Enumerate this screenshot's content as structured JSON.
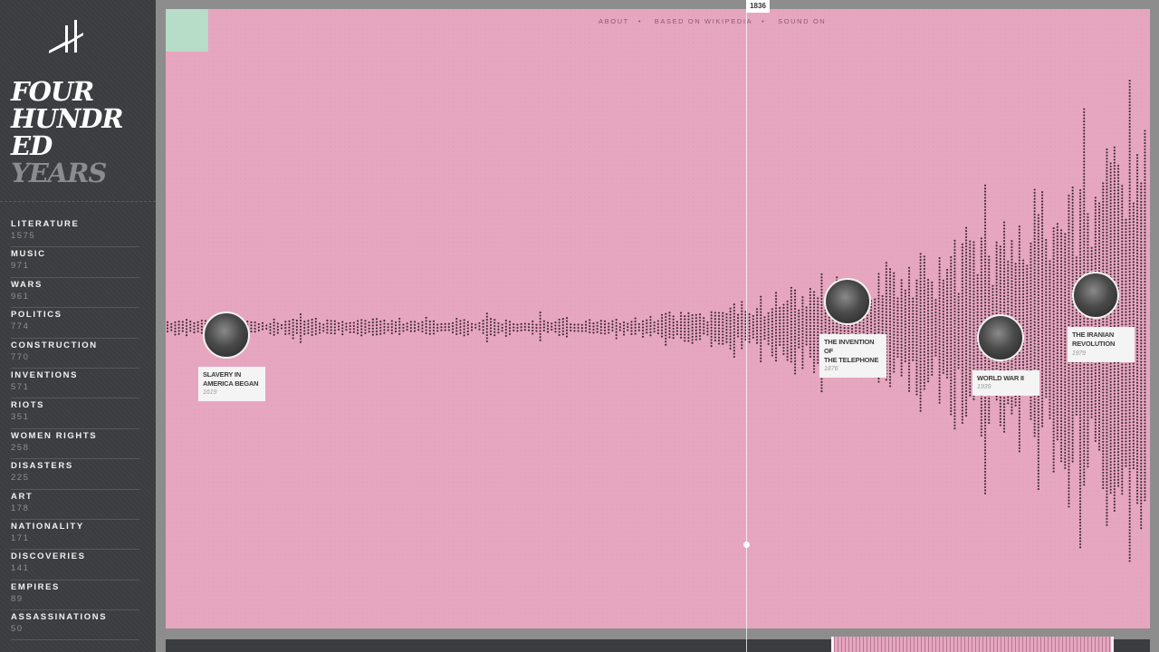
{
  "app": {
    "title_lines": [
      "FOUR",
      "HUNDR",
      "ED"
    ],
    "title_muted": "YEARS"
  },
  "nav": {
    "about": "ABOUT",
    "based_on": "BASED ON WIKIPEDIA",
    "sound": "SOUND ON"
  },
  "categories": [
    {
      "name": "LITERATURE",
      "count": "1575"
    },
    {
      "name": "MUSIC",
      "count": "971"
    },
    {
      "name": "WARS",
      "count": "961"
    },
    {
      "name": "POLITICS",
      "count": "774"
    },
    {
      "name": "CONSTRUCTION",
      "count": "770"
    },
    {
      "name": "INVENTIONS",
      "count": "571"
    },
    {
      "name": "RIOTS",
      "count": "351"
    },
    {
      "name": "WOMEN RIGHTS",
      "count": "258"
    },
    {
      "name": "DISASTERS",
      "count": "225"
    },
    {
      "name": "ART",
      "count": "178"
    },
    {
      "name": "NATIONALITY",
      "count": "171"
    },
    {
      "name": "DISCOVERIES",
      "count": "141"
    },
    {
      "name": "EMPIRES",
      "count": "89"
    },
    {
      "name": "ASSASSINATIONS",
      "count": "50"
    }
  ],
  "cursor": {
    "year": "1836"
  },
  "events": [
    {
      "title_lines": [
        "SLAVERY IN",
        "AMERICA BEGAN"
      ],
      "year": "1619",
      "icon": "slavery-photo-icon"
    },
    {
      "title_lines": [
        "THE INVENTION OF",
        "THE TELEPHONE"
      ],
      "year": "1876",
      "icon": "telephone-photo-icon"
    },
    {
      "title_lines": [
        "WORLD WAR II"
      ],
      "year": "1939",
      "icon": "ww2-portrait-icon"
    },
    {
      "title_lines": [
        "THE IRANIAN",
        "REVOLUTION"
      ],
      "year": "1979",
      "icon": "khomeini-portrait-icon"
    }
  ],
  "colors": {
    "background": "#e7a6c0",
    "sidebar": "#3a3c3f",
    "dots": "#3b2a32",
    "accent_square": "#b7dcc8"
  }
}
